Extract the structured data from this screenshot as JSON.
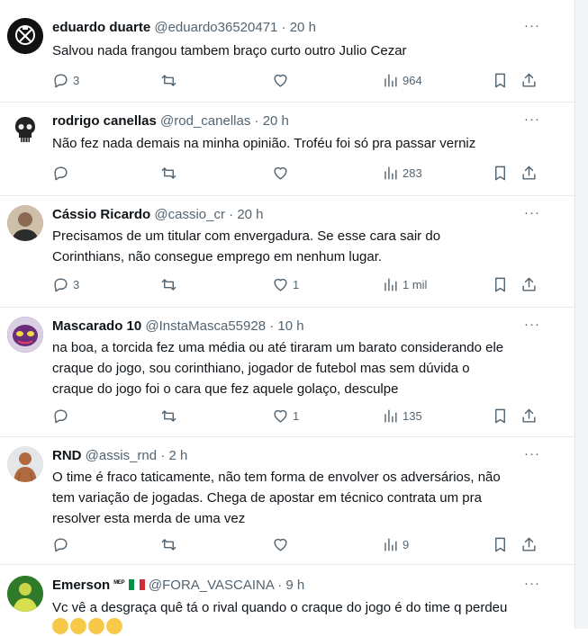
{
  "tweets": [
    {
      "name": "eduardo duarte",
      "handle": "@eduardo36520471",
      "sep": "·",
      "time": "20 h",
      "text": "Salvou nada frangou tambem braço curto outro Julio Cezar",
      "replies": "3",
      "retweets": "",
      "likes": "",
      "views": "964",
      "avatar_icon": "corinthians-logo-icon"
    },
    {
      "name": "rodrigo canellas",
      "handle": "@rod_canellas",
      "sep": "·",
      "time": "20 h",
      "text": "Não fez nada demais na minha opinião. Troféu foi só pra passar verniz",
      "replies": "",
      "retweets": "",
      "likes": "",
      "views": "283",
      "avatar_icon": "skull-icon"
    },
    {
      "name": "Cássio Ricardo",
      "handle": "@cassio_cr",
      "sep": "·",
      "time": "20 h",
      "text_lines": [
        "Precisamos de um titular com envergadura. Se esse cara sair do",
        "Corinthians, não consegue emprego em nenhum lugar."
      ],
      "replies": "3",
      "retweets": "",
      "likes": "1",
      "views": "1 mil",
      "avatar_icon": "person-photo-icon"
    },
    {
      "name": "Mascarado 10",
      "handle": "@InstaMasca55928",
      "sep": "·",
      "time": "10 h",
      "text_lines": [
        "na boa, a torcida fez uma média ou até tiraram um barato considerando ele",
        "craque do jogo, sou corinthiano, jogador de futebol mas sem dúvida o",
        "craque do jogo foi o cara que fez aquele golaço, desculpe"
      ],
      "replies": "",
      "retweets": "",
      "likes": "1",
      "views": "135",
      "avatar_icon": "mask-icon"
    },
    {
      "name": "RND",
      "handle": "@assis_rnd",
      "sep": "·",
      "time": "2 h",
      "text_lines": [
        "O time é fraco taticamente, não tem forma de envolver os adversários, não",
        "tem variação de jogadas. Chega de apostar em técnico contrata um pra",
        "resolver esta merda de uma vez"
      ],
      "replies": "",
      "retweets": "",
      "likes": "",
      "views": "9",
      "avatar_icon": "person-photo-icon"
    },
    {
      "name": "Emerson",
      "badge": "ᴹᴱᴾ",
      "handle": "@FORA_VASCAINA",
      "sep": "·",
      "time": "9 h",
      "text": "Vc vê a desgraça quê tá o rival quando o craque do jogo é do time q perdeu",
      "avatar_icon": "person-photo-icon",
      "flag_icon": "italy-flag-icon",
      "emoji_icon": "laughing-emoji-icon"
    }
  ],
  "colors": {
    "text": "#0f1419",
    "muted": "#536471",
    "divider": "#e7e9ea"
  }
}
